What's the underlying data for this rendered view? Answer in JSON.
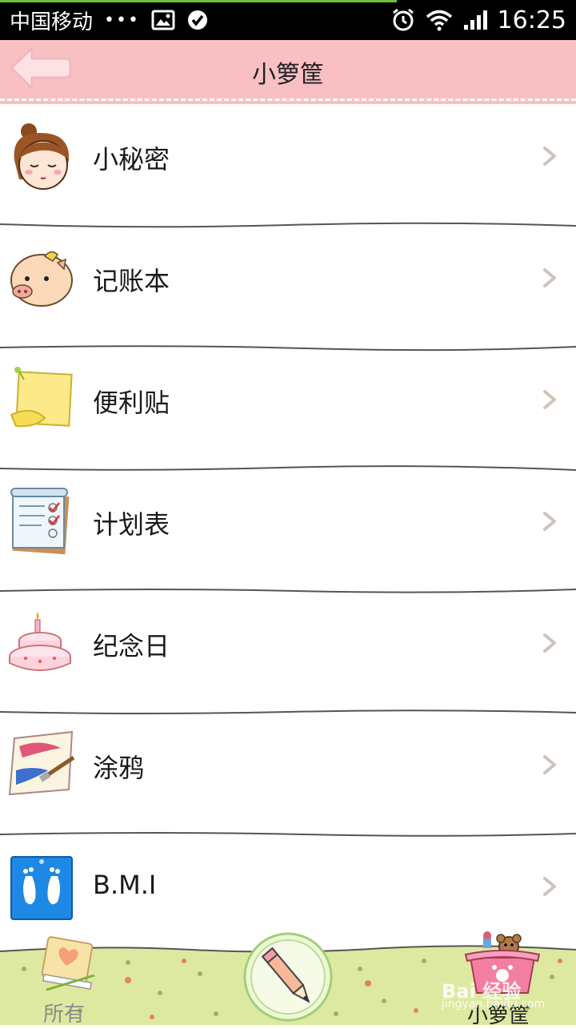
{
  "status_bar": {
    "carrier": "中国移动",
    "dots": "•••",
    "time": "16:25"
  },
  "header": {
    "title": "小箩筐"
  },
  "list": {
    "items": [
      {
        "label": "小秘密",
        "icon": "girl-face-icon"
      },
      {
        "label": "记账本",
        "icon": "piggy-icon"
      },
      {
        "label": "便利贴",
        "icon": "sticky-note-icon"
      },
      {
        "label": "计划表",
        "icon": "checklist-icon"
      },
      {
        "label": "纪念日",
        "icon": "birthday-cake-icon"
      },
      {
        "label": "涂鸦",
        "icon": "paint-brush-icon"
      },
      {
        "label": "B.M.I",
        "icon": "footprints-icon"
      }
    ]
  },
  "bottom_bar": {
    "all_label": "所有",
    "basket_label": "小箩筐",
    "watermark": "Bai 经验",
    "watermark_sub": "jingyan.baidu.com"
  },
  "colors": {
    "header_bg": "#f9c0c3",
    "grass": "#dde9a0"
  }
}
